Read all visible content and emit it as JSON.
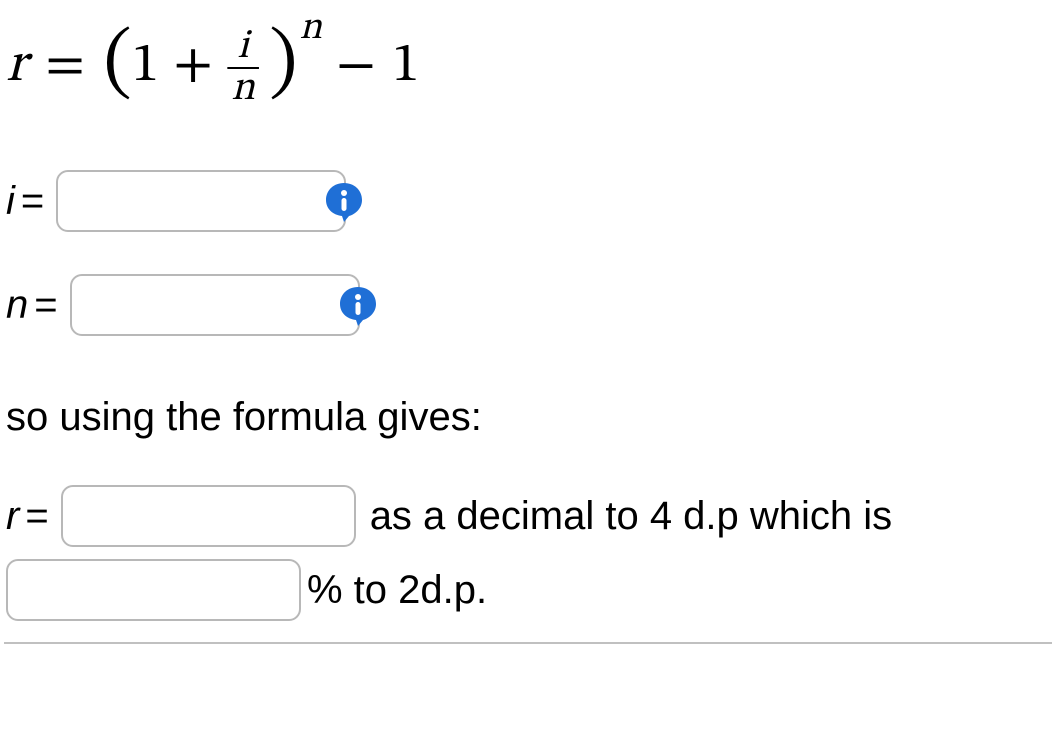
{
  "formula": {
    "lhs_var": "r",
    "equals": "=",
    "open": "(",
    "one": "1",
    "plus": "+",
    "frac_num": "i",
    "frac_den": "n",
    "close": ")",
    "exponent": "n",
    "minus": "−",
    "trailing_one": "1"
  },
  "inputs": {
    "i": {
      "label_var": "i",
      "label_eq": "=",
      "value": "",
      "info_glyph": "i"
    },
    "n": {
      "label_var": "n",
      "label_eq": "=",
      "value": "",
      "info_glyph": "i"
    }
  },
  "prompt_text": "so using the formula gives:",
  "result": {
    "r_label_var": "r",
    "r_label_eq": "=",
    "r_value": "",
    "r_trail": "as a decimal to 4 d.p which is",
    "pct_value": "",
    "pct_unit": "% to 2d.p."
  }
}
